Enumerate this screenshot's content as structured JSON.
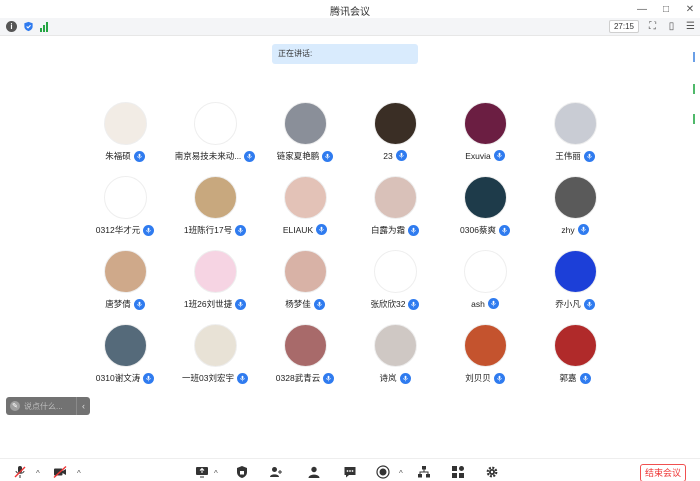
{
  "window": {
    "title": "腾讯会议"
  },
  "status": {
    "timer": "27:15"
  },
  "speaking_label": "正在讲话:",
  "participants": [
    {
      "name": "朱福硕"
    },
    {
      "name": "南京易技未来动..."
    },
    {
      "name": "链家夏艳鹏"
    },
    {
      "name": "23"
    },
    {
      "name": "Exuvia"
    },
    {
      "name": "王伟丽"
    },
    {
      "name": "0312华才元"
    },
    {
      "name": "1班陈行17号"
    },
    {
      "name": "ELIAUK"
    },
    {
      "name": "白露为霜"
    },
    {
      "name": "0306蔡爽"
    },
    {
      "name": "zhy"
    },
    {
      "name": "唐梦倩"
    },
    {
      "name": "1班26刘世捷"
    },
    {
      "name": "杨梦佳"
    },
    {
      "name": "张欣欣32"
    },
    {
      "name": "ash"
    },
    {
      "name": "乔小凡"
    },
    {
      "name": "0310谢文涛"
    },
    {
      "name": "一班03刘宏宇"
    },
    {
      "name": "0328武青云"
    },
    {
      "name": "诗岚"
    },
    {
      "name": "刘贝贝"
    },
    {
      "name": "郭嘉"
    }
  ],
  "chat": {
    "placeholder": "说点什么..."
  },
  "toolbar": {
    "end_label": "结束会议"
  },
  "colors": {
    "accent": "#2f7bef",
    "end": "#f05050",
    "speaking_bg": "#d9ebfd"
  }
}
